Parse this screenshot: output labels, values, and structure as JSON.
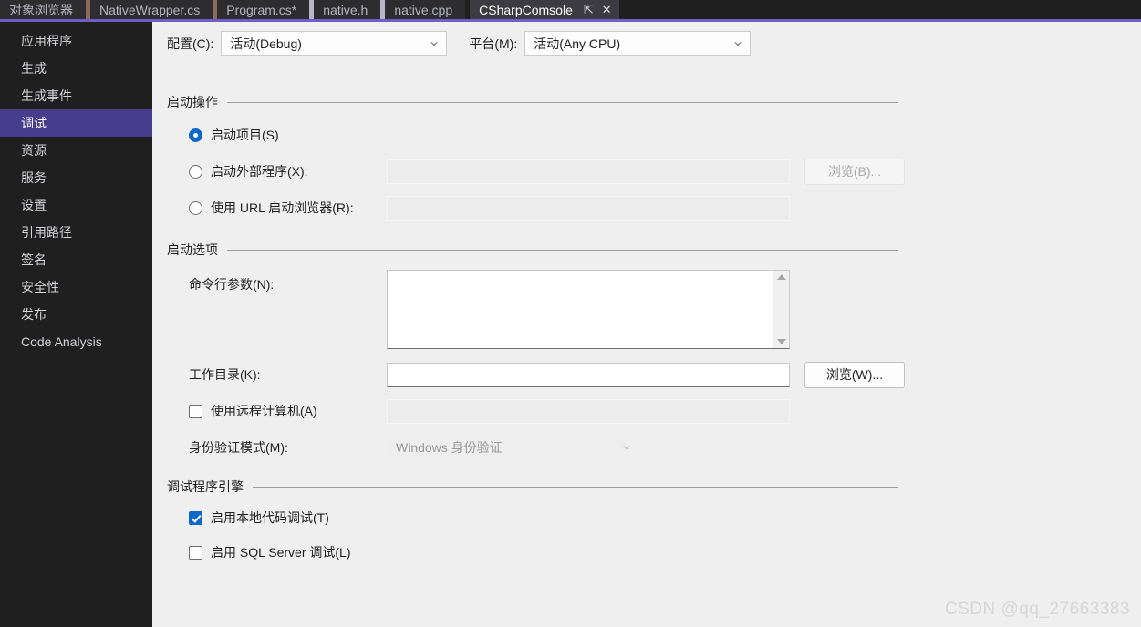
{
  "tabs": [
    {
      "label": "对象浏览器",
      "active": false,
      "separator_after": "tan"
    },
    {
      "label": "NativeWrapper.cs",
      "active": false,
      "separator_after": "tan"
    },
    {
      "label": "Program.cs*",
      "active": false,
      "separator_after": "pale"
    },
    {
      "label": "native.h",
      "active": false,
      "separator_after": "pale"
    },
    {
      "label": "native.cpp",
      "active": false,
      "separator_after": "none"
    },
    {
      "label": "CSharpComsole",
      "active": true,
      "separator_after": "none"
    }
  ],
  "tab_controls": {
    "pin_icon": "pin-icon",
    "close_icon": "close-icon",
    "pin_glyph": "⇱",
    "close_glyph": "✕"
  },
  "sidebar": {
    "items": [
      {
        "label": "应用程序",
        "selected": false
      },
      {
        "label": "生成",
        "selected": false
      },
      {
        "label": "生成事件",
        "selected": false
      },
      {
        "label": "调试",
        "selected": true
      },
      {
        "label": "资源",
        "selected": false
      },
      {
        "label": "服务",
        "selected": false
      },
      {
        "label": "设置",
        "selected": false
      },
      {
        "label": "引用路径",
        "selected": false
      },
      {
        "label": "签名",
        "selected": false
      },
      {
        "label": "安全性",
        "selected": false
      },
      {
        "label": "发布",
        "selected": false
      },
      {
        "label": "Code Analysis",
        "selected": false
      }
    ]
  },
  "config_row": {
    "configuration_label": "配置(C):",
    "configuration_value": "活动(Debug)",
    "platform_label": "平台(M):",
    "platform_value": "活动(Any CPU)"
  },
  "start_action": {
    "title": "启动操作",
    "options": [
      {
        "label": "启动项目(S)",
        "checked": true
      },
      {
        "label": "启动外部程序(X):",
        "checked": false
      },
      {
        "label": "使用 URL 启动浏览器(R):",
        "checked": false
      }
    ],
    "external_program_value": "",
    "url_value": "",
    "browse_button_label": "浏览(B)..."
  },
  "start_options": {
    "title": "启动选项",
    "command_line_label": "命令行参数(N):",
    "command_line_value": "",
    "working_dir_label": "工作目录(K):",
    "working_dir_value": "",
    "browse_button_label": "浏览(W)...",
    "remote_machine_label": "使用远程计算机(A)",
    "remote_machine_checked": false,
    "remote_machine_value": "",
    "auth_mode_label": "身份验证模式(M):",
    "auth_mode_value": "Windows 身份验证"
  },
  "debugger_engines": {
    "title": "调试程序引擎",
    "options": [
      {
        "label": "启用本地代码调试(T)",
        "checked": true
      },
      {
        "label": "启用 SQL Server 调试(L)",
        "checked": false
      }
    ]
  },
  "watermark": {
    "text": "CSDN @qq_27663383"
  },
  "colors": {
    "accent_purple": "#6c5fc7",
    "sidebar_selected": "#473d8c",
    "control_blue": "#0d68c8",
    "tab_bar_bg": "#1f1f20",
    "content_bg": "#efefef"
  }
}
